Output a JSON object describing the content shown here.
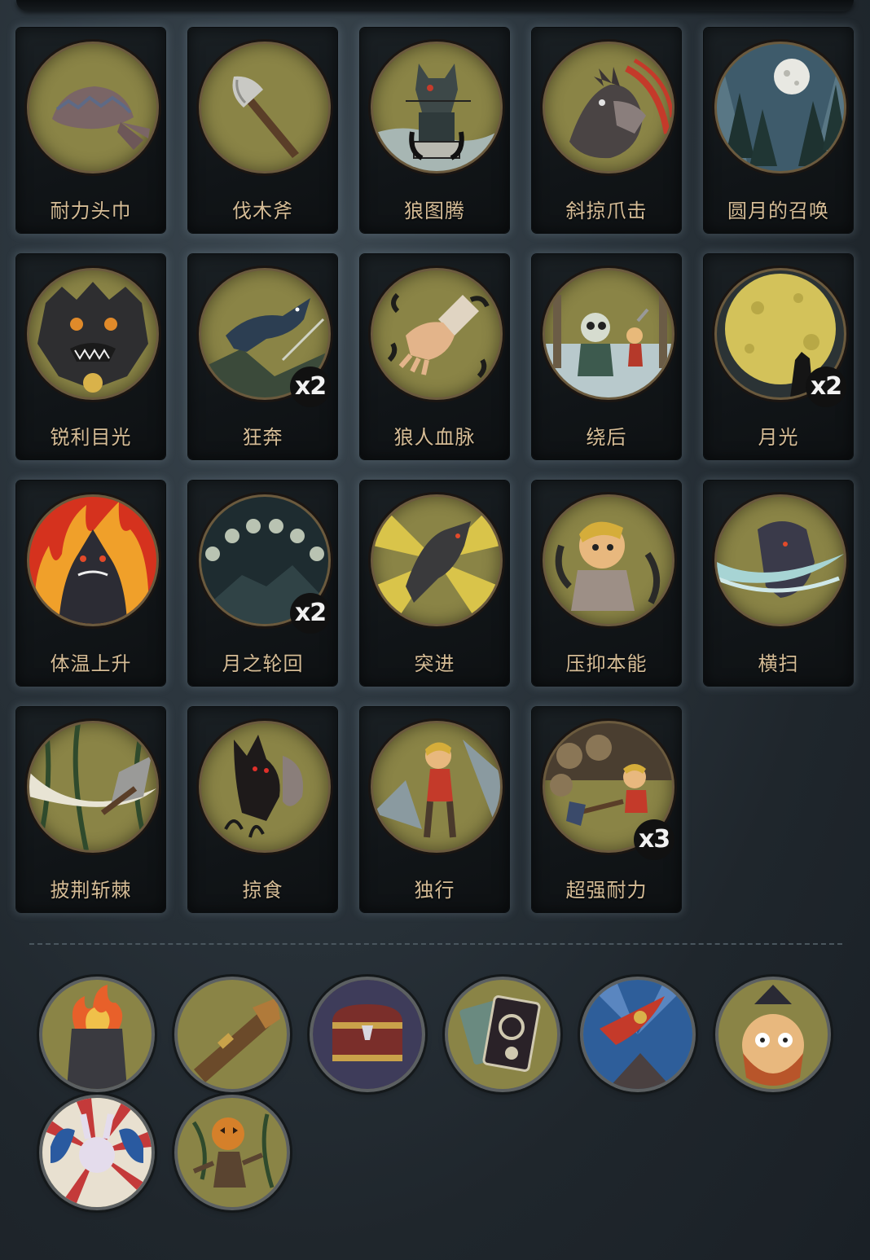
{
  "cards": [
    {
      "label": "耐力头巾",
      "icon": "bandana-icon",
      "badge": ""
    },
    {
      "label": "伐木斧",
      "icon": "axe-icon",
      "badge": ""
    },
    {
      "label": "狼图腾",
      "icon": "wolf-totem-icon",
      "badge": ""
    },
    {
      "label": "斜掠爪击",
      "icon": "claw-strike-icon",
      "badge": ""
    },
    {
      "label": "圆月的召唤",
      "icon": "full-moon-forest-icon",
      "badge": ""
    },
    {
      "label": "锐利目光",
      "icon": "glaring-wolf-icon",
      "badge": ""
    },
    {
      "label": "狂奔",
      "icon": "leaping-wolf-icon",
      "badge": "x2"
    },
    {
      "label": "狼人血脉",
      "icon": "clawed-hand-icon",
      "badge": ""
    },
    {
      "label": "绕后",
      "icon": "skeleton-ambush-icon",
      "badge": ""
    },
    {
      "label": "月光",
      "icon": "moon-howl-icon",
      "badge": "x2"
    },
    {
      "label": "体温上升",
      "icon": "burning-wolf-icon",
      "badge": ""
    },
    {
      "label": "月之轮回",
      "icon": "moon-phases-icon",
      "badge": "x2"
    },
    {
      "label": "突进",
      "icon": "pouncing-wolf-icon",
      "badge": ""
    },
    {
      "label": "压抑本能",
      "icon": "suppressed-boy-icon",
      "badge": ""
    },
    {
      "label": "横扫",
      "icon": "sweeping-wolf-icon",
      "badge": ""
    },
    {
      "label": "披荆斩棘",
      "icon": "axe-thorns-icon",
      "badge": ""
    },
    {
      "label": "掠食",
      "icon": "predator-wolf-icon",
      "badge": ""
    },
    {
      "label": "独行",
      "icon": "lone-boy-icon",
      "badge": ""
    },
    {
      "label": "超强耐力",
      "icon": "chopping-boy-icon",
      "badge": "x3"
    }
  ],
  "relics": [
    {
      "icon": "flaming-altar-icon"
    },
    {
      "icon": "spyglass-icon"
    },
    {
      "icon": "treasure-chest-icon"
    },
    {
      "icon": "skull-card-icon"
    },
    {
      "icon": "flying-warrior-icon"
    },
    {
      "icon": "scared-captain-icon"
    },
    {
      "icon": "jester-rabbit-icon"
    },
    {
      "icon": "pumpkin-scarecrow-icon"
    }
  ],
  "colors": {
    "medallion_bg": "#8a8446",
    "label_text": "#d5bc96",
    "card_bg": "#111518"
  }
}
